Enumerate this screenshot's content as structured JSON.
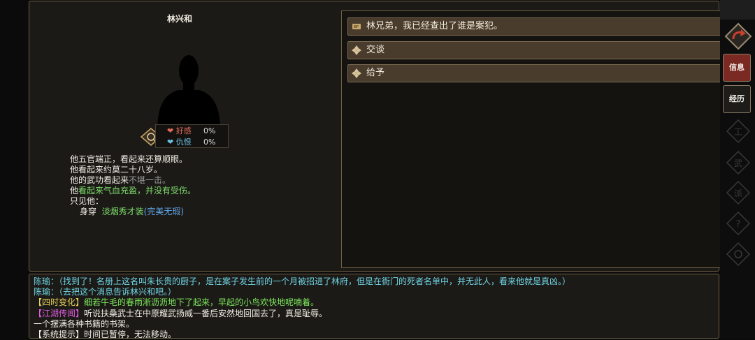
{
  "character": {
    "name": "林兴和",
    "relation": {
      "good_label": "好感",
      "good_value": "0%",
      "hate_label": "仇恨",
      "hate_value": "0%"
    },
    "description": {
      "line1": "他五官端正，看起来还算顺眼。",
      "line2": "他看起来约莫二十八岁。",
      "line3_prefix": "他的武功看起来",
      "line3_value": "不堪一击。",
      "line4_prefix": "他",
      "line4_value": "看起来气血充盈，并没有受伤。",
      "line5": "只见他：",
      "wear_label": "身穿",
      "wear_item": "淡烟秀才装",
      "wear_quality": "(完美无瑕)"
    }
  },
  "options": [
    {
      "label": "林兄弟，我已经查出了谁是案犯。",
      "icon": "quest-scroll-icon"
    },
    {
      "label": "交谈",
      "icon": "diamond-icon"
    },
    {
      "label": "给予",
      "icon": "diamond-icon"
    }
  ],
  "log": {
    "line1": "陈瑜：（找到了！名册上这名叫朱长贵的厨子，是在案子发生前的一个月被招进了林府，但是在衙门的死者名单中，并无此人，看来他就是真凶。）",
    "line2": "陈瑜：（去把这个消息告诉林兴和吧。）",
    "line3_tag": "【四时变化】",
    "line3_text": "细若牛毛的春雨淅沥沥地下了起来，早起的小鸟欢快地呢喃着。",
    "line4_tag": "【江湖传闻】",
    "line4_text": "听说扶桑武士在中原耀武扬威一番后安然地回国去了，真是耻辱。",
    "line5": "一个摆满各种书籍的书架。",
    "line6": "【系统提示】时间已暂停，无法移动。"
  },
  "sidebar": {
    "info_label": "信息",
    "exp_label": "经历"
  },
  "colors": {
    "panel_bg": "#1c1a17",
    "border": "#6e5e44",
    "option_bg": "#4a3c2d",
    "active_tab": "#7a2a22",
    "good": "#e06a5a",
    "hate": "#6ac2e0"
  }
}
